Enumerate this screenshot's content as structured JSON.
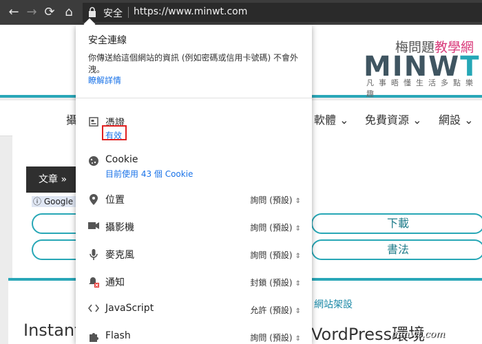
{
  "browser": {
    "secure_label": "安全",
    "url": "https://www.minwt.com",
    "icons": [
      "back-icon",
      "forward-icon",
      "reload-icon",
      "home-icon",
      "lock-icon"
    ]
  },
  "website": {
    "brand_sub_prefix": "梅問題",
    "brand_sub_accent": "教學網",
    "logo_main": "MINW",
    "logo_accent": "T",
    "slogan": "凡事晤懂生活多點樂趣",
    "menu": [
      "攝",
      "軟體",
      "免費資源",
      "網設"
    ],
    "article_tab": "文章",
    "google_chip": "Google",
    "pills": [
      "",
      "",
      "下載",
      "書法"
    ],
    "breadcrumb": "網站架設",
    "title_left": "InstantV",
    "title_right": "VordPress環境",
    "watermark": "minwt.com",
    "colors": {
      "teal": "#2aa7b8",
      "pink": "#d93a7a"
    }
  },
  "popup": {
    "title": "安全連線",
    "description": "你傳送給這個網站的資訊 (例如密碼或信用卡號碼) 不會外洩。",
    "learn_more": "瞭解詳情",
    "certificate": {
      "label": "憑證",
      "status": "有效"
    },
    "cookie": {
      "label": "Cookie",
      "usage": "目前使用 43 個 Cookie"
    },
    "permissions": [
      {
        "icon": "location-pin-icon",
        "label": "位置",
        "value": "詢問 (預設)"
      },
      {
        "icon": "camera-icon",
        "label": "攝影機",
        "value": "詢問 (預設)"
      },
      {
        "icon": "microphone-icon",
        "label": "麥克風",
        "value": "詢問 (預設)"
      },
      {
        "icon": "notification-bell-icon",
        "label": "通知",
        "value": "封鎖 (預設)"
      },
      {
        "icon": "code-icon",
        "label": "JavaScript",
        "value": "允許 (預設)"
      },
      {
        "icon": "puzzle-icon",
        "label": "Flash",
        "value": "詢問 (預設)"
      }
    ],
    "highlight_color": "#e02020"
  }
}
